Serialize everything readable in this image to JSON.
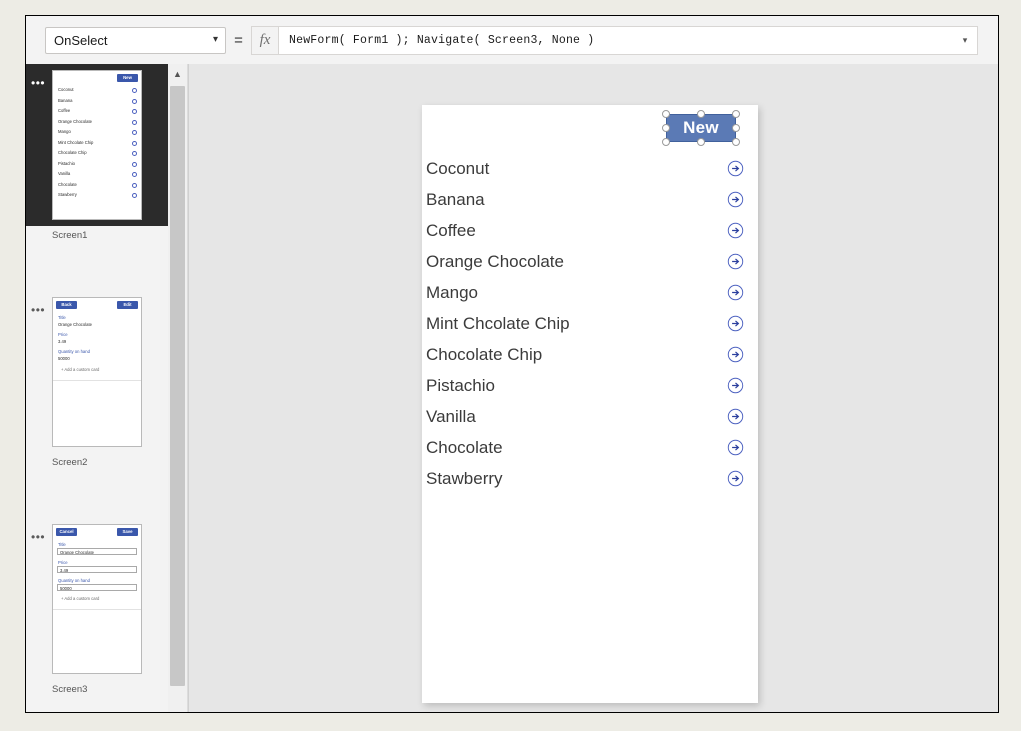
{
  "formula_bar": {
    "property": "OnSelect",
    "property_options": [
      "OnSelect"
    ],
    "equals": "=",
    "fx_label": "fx",
    "formula": "NewForm( Form1 ); Navigate( Screen3, None )",
    "expand_icon": "chevron-down"
  },
  "screens": [
    {
      "name": "Screen1",
      "selected": true,
      "menu": "•••",
      "type": "gallery",
      "button": "New",
      "items": [
        "Coconut",
        "Banana",
        "Coffee",
        "Orange Chocolate",
        "Mango",
        "Mint Chcolate Chip",
        "Chocolate Chip",
        "Pistachio",
        "Vanilla",
        "Chocolate",
        "Stawberry"
      ]
    },
    {
      "name": "Screen2",
      "selected": false,
      "menu": "•••",
      "type": "detail-form",
      "left_button": "Back",
      "right_button": "Edit",
      "fields": [
        {
          "label": "Title",
          "value": "Orange Chocolate"
        },
        {
          "label": "Price",
          "value": "3.49"
        },
        {
          "label": "Quantity on hand",
          "value": "50000"
        }
      ],
      "add_card": "+  Add a custom card"
    },
    {
      "name": "Screen3",
      "selected": false,
      "menu": "•••",
      "type": "edit-form",
      "left_button": "Cancel",
      "right_button": "Save",
      "fields": [
        {
          "label": "Title",
          "value": "Orange Chocolate"
        },
        {
          "label": "Price",
          "value": "3.49"
        },
        {
          "label": "Quantity on hand",
          "value": "50000"
        }
      ],
      "add_card": "+  Add a custom card"
    }
  ],
  "canvas": {
    "new_button": "New",
    "gallery_items": [
      "Coconut",
      "Banana",
      "Coffee",
      "Orange Chocolate",
      "Mango",
      "Mint Chcolate Chip",
      "Chocolate Chip",
      "Pistachio",
      "Vanilla",
      "Chocolate",
      "Stawberry"
    ]
  },
  "scrollbar": {
    "up_icon": "chevron-up"
  },
  "colors": {
    "selected_button_fill": "#5b7ab5",
    "thumb_button_fill": "#3a57ab",
    "arrow_blue": "#4a5fbf",
    "canvas_bg": "#e6e6e6",
    "selected_screen_bg": "#2b2b2b"
  }
}
